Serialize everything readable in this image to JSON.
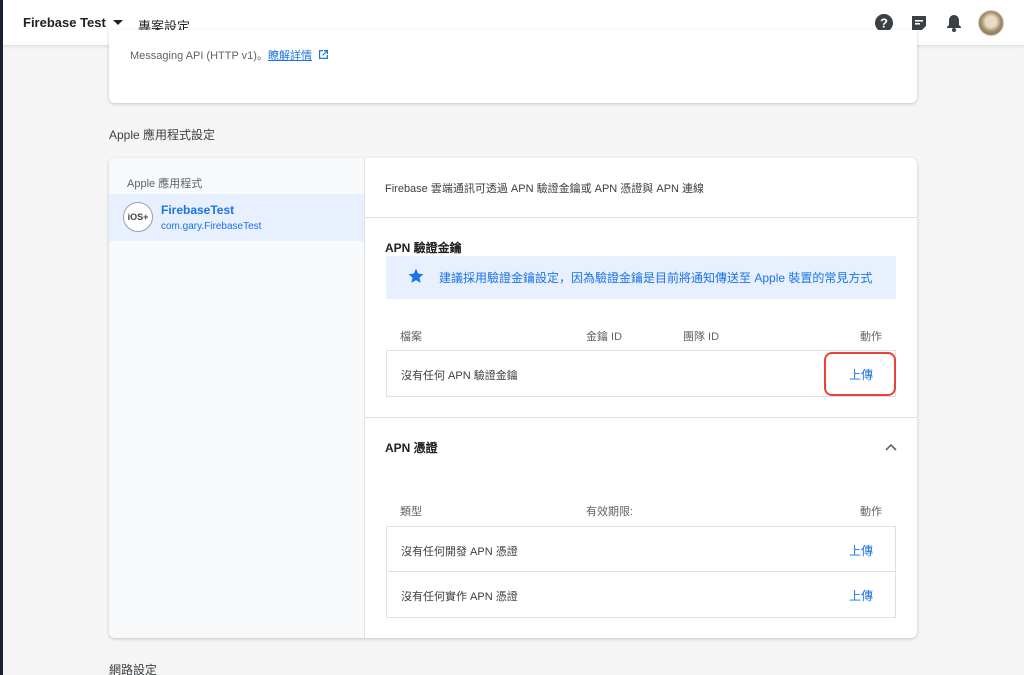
{
  "topbar": {
    "project_name": "Firebase Test",
    "page_title": "專案設定",
    "icons": [
      "help-icon",
      "feedback-icon",
      "notifications-icon",
      "avatar"
    ]
  },
  "messaging": {
    "text": "Messaging API (HTTP v1)。",
    "link": "瞭解詳情"
  },
  "apple_section": {
    "title": "Apple 應用程式設定",
    "sidebar_header": "Apple 應用程式",
    "app": {
      "badge": "iOS+",
      "name": "FirebaseTest",
      "bundle": "com.gary.FirebaseTest"
    },
    "intro": "Firebase 雲端通訊可透過 APN 驗證金鑰或 APN 憑證與 APN 連線",
    "auth_key": {
      "title": "APN 驗證金鑰",
      "banner": "建議採用驗證金鑰設定，因為驗證金鑰是目前將通知傳送至 Apple 裝置的常見方式",
      "columns": [
        "檔案",
        "金鑰 ID",
        "團隊 ID",
        "動作"
      ],
      "rows": [
        {
          "text": "沒有任何 APN 驗證金鑰",
          "action": "上傳"
        }
      ]
    },
    "certs": {
      "title": "APN 憑證",
      "columns": [
        "類型",
        "有效期限:",
        "動作"
      ],
      "rows": [
        {
          "text": "沒有任何開發 APN 憑證",
          "action": "上傳"
        },
        {
          "text": "沒有任何實作 APN 憑證",
          "action": "上傳"
        }
      ]
    }
  },
  "network_section": {
    "title": "網路設定"
  },
  "colors": {
    "accent": "#1a73e8",
    "highlight": "#ea4335",
    "banner_bg": "#e8f0fe"
  }
}
